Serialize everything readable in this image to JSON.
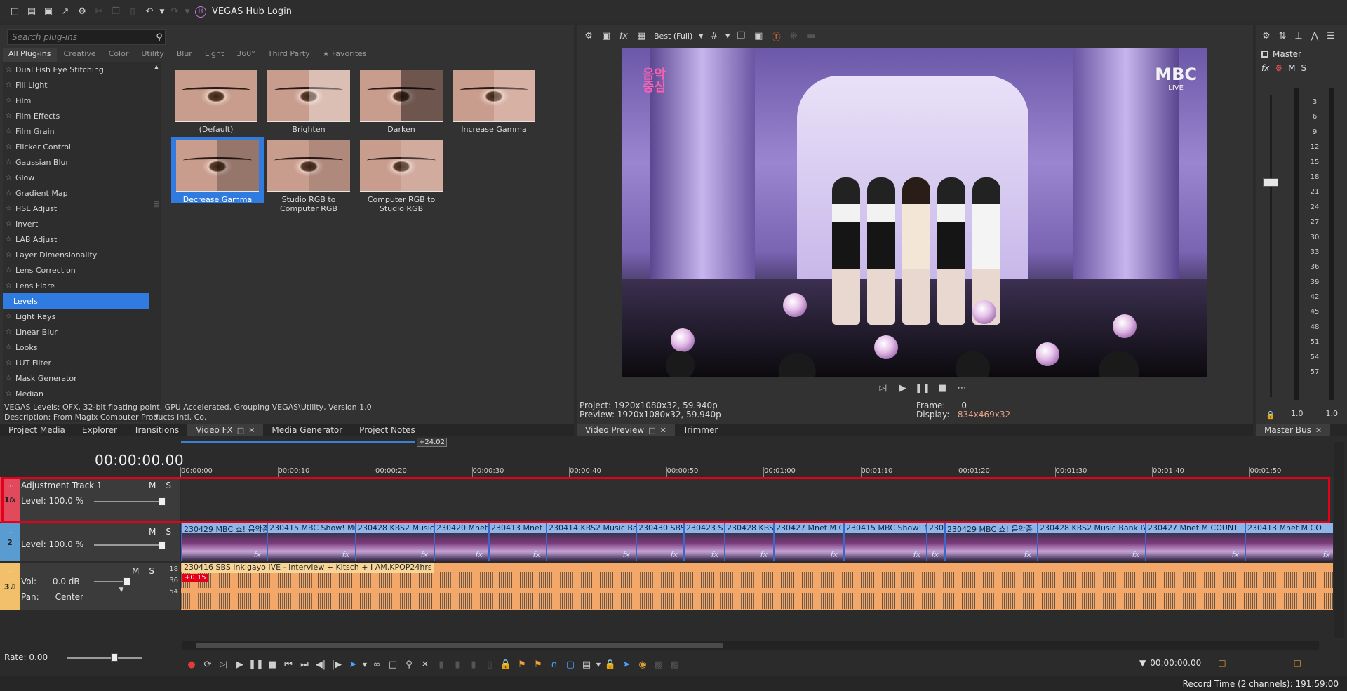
{
  "app": {
    "title": "VEGAS Hub Login",
    "hub_badge": "H"
  },
  "plugins": {
    "search_placeholder": "Search plug-ins",
    "tabs": [
      "All Plug-ins",
      "Creative",
      "Color",
      "Utility",
      "Blur",
      "Light",
      "360°",
      "Third Party",
      "Favorites"
    ],
    "list": [
      "Dual Fish Eye Stitching",
      "Fill Light",
      "Film",
      "Film Effects",
      "Film Grain",
      "Flicker Control",
      "Gaussian Blur",
      "Glow",
      "Gradient Map",
      "HSL Adjust",
      "Invert",
      "LAB Adjust",
      "Layer Dimensionality",
      "Lens Correction",
      "Lens Flare",
      "Levels",
      "Light Rays",
      "Linear Blur",
      "Looks",
      "LUT Filter",
      "Mask Generator",
      "Median"
    ],
    "selected": "Levels",
    "presets": [
      "(Default)",
      "Brighten",
      "Darken",
      "Increase Gamma",
      "Decrease Gamma",
      "Studio RGB to Computer RGB",
      "Computer RGB to Studio RGB"
    ],
    "selected_preset": "Decrease Gamma",
    "info_line1": "VEGAS Levels: OFX, 32-bit floating point, GPU Accelerated, Grouping VEGAS\\Utility, Version 1.0",
    "info_line2": "Description: From Magix Computer Products Intl. Co."
  },
  "preview": {
    "quality": "Best (Full)",
    "project": "Project:  1920x1080x32, 59.940p",
    "preview": "Preview: 1920x1080x32, 59.940p",
    "frame_label": "Frame:",
    "frame_value": "0",
    "display_label": "Display:",
    "display_value": "834x469x32",
    "logo_right": "MBC",
    "logo_right_sub": "LIVE",
    "logo_left": "음악중심"
  },
  "master": {
    "label": "Master",
    "fx": "fx",
    "m": "M",
    "s": "S",
    "scale": [
      "3",
      "6",
      "9",
      "12",
      "15",
      "18",
      "21",
      "24",
      "27",
      "30",
      "33",
      "36",
      "39",
      "42",
      "45",
      "48",
      "51",
      "54",
      "57"
    ],
    "left_value": "1.0",
    "right_value": "1.0"
  },
  "docktabs": {
    "left": [
      "Project Media",
      "Explorer",
      "Transitions",
      "Video FX",
      "Media Generator",
      "Project Notes"
    ],
    "left_active": "Video FX",
    "mid": [
      "Video Preview",
      "Trimmer"
    ],
    "mid_active": "Video Preview",
    "right": [
      "Master Bus"
    ]
  },
  "timeline": {
    "timecode": "00:00:00.00",
    "loop_flag": "+24.02",
    "ruler": [
      "00:00:00",
      "00:00:10",
      "00:00:20",
      "00:00:30",
      "00:00:40",
      "00:00:50",
      "00:01:00",
      "00:01:10",
      "00:01:20",
      "00:01:30",
      "00:01:40",
      "00:01:50"
    ],
    "track1": {
      "num": "1",
      "name": "Adjustment Track 1",
      "level": "Level: 100.0 %",
      "m": "M",
      "s": "S"
    },
    "track2": {
      "num": "2",
      "level": "Level: 100.0 %",
      "m": "M",
      "s": "S",
      "clips": [
        "230429 MBC 쇼! 음악중",
        "230415 MBC Show! Mu",
        "230428 KBS2 Music",
        "230420 Mnet",
        "230413 Mnet",
        "230414 KBS2 Music Ba",
        "230430 SBS",
        "230423 S",
        "230428 KBS",
        "230427 Mnet M C",
        "230415 MBC Show! M",
        "230",
        "230429 MBC 쇼! 음악중",
        "230428 KBS2 Music Bank IV",
        "230427 Mnet M COUNT",
        "230413 Mnet M CO"
      ],
      "fx": "fx"
    },
    "track3": {
      "num": "3",
      "vol_label": "Vol:",
      "vol": "0.0 dB",
      "pan_label": "Pan:",
      "pan": "Center",
      "m": "M",
      "s": "S",
      "clip_title": "230416 SBS Inkigayo IVE - Interview + Kitsch + I AM.KPOP24hrs",
      "badge": "+0.15"
    },
    "db_scale": [
      "18",
      "36",
      "54"
    ],
    "rate": "Rate: 0.00",
    "cursor_time": "00:00:00.00"
  },
  "status": {
    "record_time": "Record Time (2 channels): 191:59:00"
  }
}
